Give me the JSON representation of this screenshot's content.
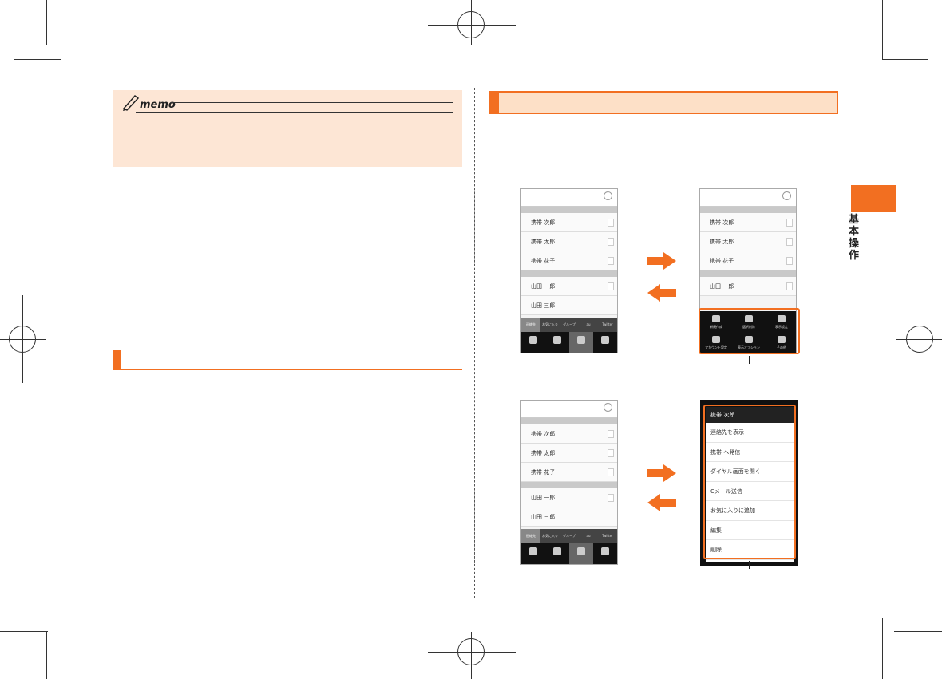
{
  "memo": {
    "label": "memo"
  },
  "side_tab": {
    "text": "基本操作"
  },
  "phone_a": {
    "rows": [
      "携帯 次郎",
      "携帯 太郎",
      "携帯 花子",
      "山田 一郎",
      "山田 三郎"
    ],
    "tabs": [
      "連絡先",
      "お気に入り",
      "グループ",
      "au",
      "Twitter"
    ]
  },
  "phone_b": {
    "rows": [
      "携帯 次郎",
      "携帯 太郎",
      "携帯 花子",
      "山田 一郎"
    ],
    "menu": [
      "新規作成",
      "選択削除",
      "表示設定",
      "アカウント設定",
      "表示オプション",
      "その他"
    ]
  },
  "phone_c": {
    "rows": [
      "携帯 次郎",
      "携帯 太郎",
      "携帯 花子",
      "山田 一郎",
      "山田 三郎"
    ],
    "tabs": [
      "連絡先",
      "お気に入り",
      "グループ",
      "au",
      "Twitter"
    ]
  },
  "context_menu": {
    "title": "携帯 次郎",
    "items": [
      "連絡先を表示",
      "携帯 へ発信",
      "ダイヤル画面を開く",
      "Cメール送信",
      "お気に入りに追加",
      "編集",
      "削除"
    ]
  },
  "colors": {
    "accent": "#f26f21",
    "memo_bg": "#fde6d5"
  }
}
